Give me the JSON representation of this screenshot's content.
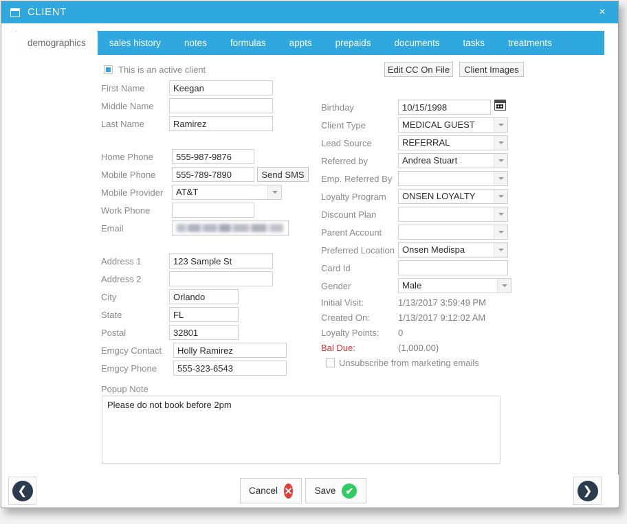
{
  "window": {
    "title": "CLIENT",
    "title_icon": "window-form-icon",
    "close_label": "×",
    "accent_color": "#2fa8e0"
  },
  "tabs": [
    {
      "label": "demographics",
      "active": true
    },
    {
      "label": "sales history",
      "active": false
    },
    {
      "label": "notes",
      "active": false
    },
    {
      "label": "formulas",
      "active": false
    },
    {
      "label": "appts",
      "active": false
    },
    {
      "label": "prepaids",
      "active": false
    },
    {
      "label": "documents",
      "active": false
    },
    {
      "label": "tasks",
      "active": false
    },
    {
      "label": "treatments",
      "active": false
    }
  ],
  "toolbar": {
    "edit_cc_label": "Edit CC On File",
    "client_images_label": "Client Images"
  },
  "active_client": {
    "label": "This is an active client",
    "checked": true
  },
  "left_form": {
    "first_name": {
      "label": "First Name",
      "value": "Keegan"
    },
    "middle_name": {
      "label": "Middle Name",
      "value": ""
    },
    "last_name": {
      "label": "Last Name",
      "value": "Ramirez"
    },
    "home_phone": {
      "label": "Home Phone",
      "value": "555-987-9876"
    },
    "mobile_phone": {
      "label": "Mobile Phone",
      "value": "555-789-7890"
    },
    "send_sms_label": "Send SMS",
    "mobile_provider": {
      "label": "Mobile Provider",
      "value": "AT&T"
    },
    "work_phone": {
      "label": "Work Phone",
      "value": ""
    },
    "email": {
      "label": "Email",
      "value": ""
    },
    "address1": {
      "label": "Address 1",
      "value": "123 Sample St"
    },
    "address2": {
      "label": "Address 2",
      "value": ""
    },
    "city": {
      "label": "City",
      "value": "Orlando"
    },
    "state": {
      "label": "State",
      "value": "FL"
    },
    "postal": {
      "label": "Postal",
      "value": "32801"
    },
    "emgcy_contact": {
      "label": "Emgcy Contact",
      "value": "Holly Ramirez"
    },
    "emgcy_phone": {
      "label": "Emgcy Phone",
      "value": "555-323-6543"
    }
  },
  "right_form": {
    "birthday": {
      "label": "Birthday",
      "value": "10/15/1998",
      "icon": "calendar-icon"
    },
    "client_type": {
      "label": "Client Type",
      "value": "MEDICAL GUEST"
    },
    "lead_source": {
      "label": "Lead Source",
      "value": "REFERRAL"
    },
    "referred_by": {
      "label": "Referred by",
      "value": "Andrea Stuart"
    },
    "emp_referred_by": {
      "label": "Emp. Referred By",
      "value": ""
    },
    "loyalty_program": {
      "label": "Loyalty Program",
      "value": "ONSEN LOYALTY"
    },
    "discount_plan": {
      "label": "Discount Plan",
      "value": ""
    },
    "parent_account": {
      "label": "Parent Account",
      "value": ""
    },
    "preferred_location": {
      "label": "Preferred Location",
      "value": "Onsen Medispa"
    },
    "card_id": {
      "label": "Card Id",
      "value": ""
    },
    "gender": {
      "label": "Gender",
      "value": "Male"
    },
    "initial_visit": {
      "label": "Initial Visit:",
      "value": "1/13/2017 3:59:49 PM"
    },
    "created_on": {
      "label": "Created On:",
      "value": "1/13/2017 9:12:02 AM"
    },
    "loyalty_points": {
      "label": "Loyalty Points:",
      "value": "0"
    },
    "bal_due": {
      "label": "Bal Due:",
      "value": "(1,000.00)",
      "label_color": "#e03131"
    },
    "unsubscribe": {
      "label": "Unsubscribe from marketing emails",
      "checked": false
    }
  },
  "popup_note": {
    "label": "Popup Note",
    "value": "Please do not book before 2pm"
  },
  "footer": {
    "prev_label": "❮",
    "next_label": "❯",
    "cancel_label": "Cancel",
    "cancel_badge": "✕",
    "save_label": "Save",
    "save_badge": "✔"
  }
}
